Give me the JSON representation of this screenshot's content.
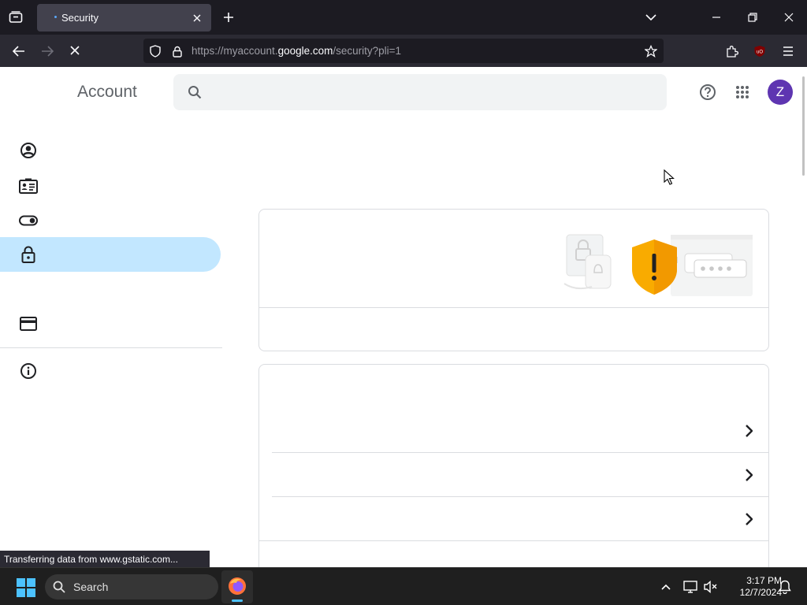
{
  "browser": {
    "tab_title": "Security",
    "url_prefix": "https://myaccount.",
    "url_domain": "google.com",
    "url_suffix": "/security?pli=1",
    "status_text": "Transferring data from www.gstatic.com..."
  },
  "page": {
    "brand": "Account",
    "avatar_letter": "Z",
    "sidebar_icons": [
      "person-circle-icon",
      "id-card-icon",
      "toggle-icon",
      "lock-icon",
      "credit-card-icon",
      "info-icon"
    ],
    "active_item": "lock-icon"
  },
  "taskbar": {
    "search_label": "Search",
    "time": "3:17 PM",
    "date": "12/7/2024"
  },
  "colors": {
    "accent_active": "#c2e7ff",
    "avatar_bg": "#5e35b1",
    "shield": "#f9ab00"
  }
}
